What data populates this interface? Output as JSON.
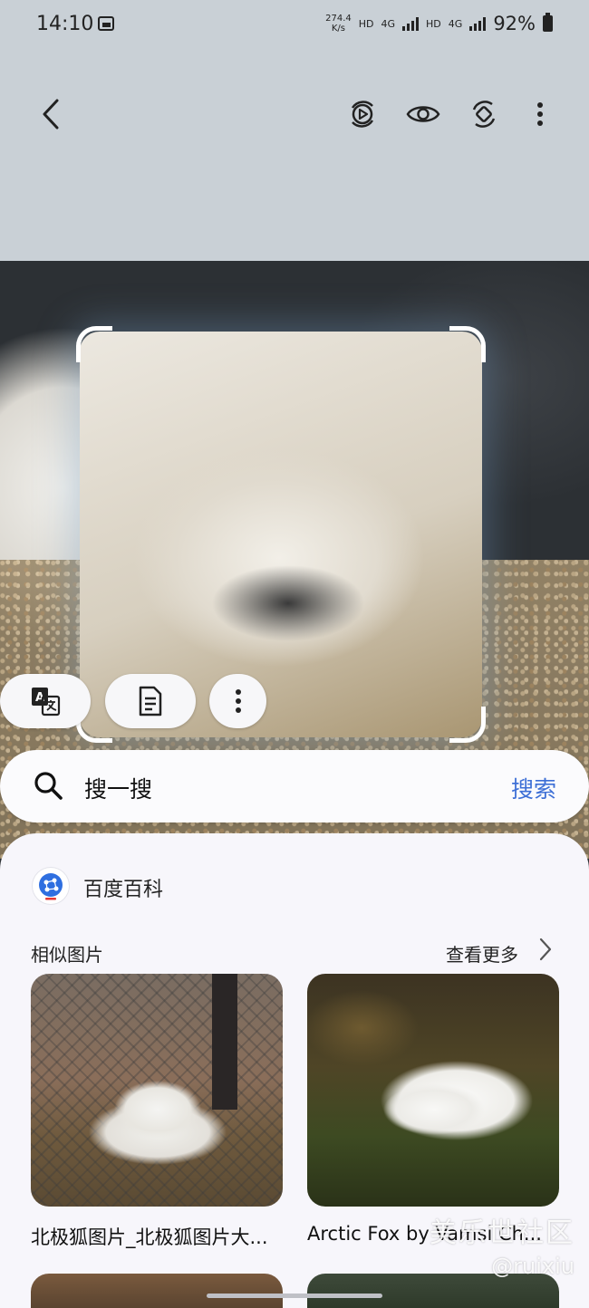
{
  "status_bar": {
    "time": "14:10",
    "speed_value": "274.4",
    "speed_unit": "K/s",
    "hd1": "HD",
    "net1": "4G",
    "hd2": "HD",
    "net2": "4G",
    "battery": "92%"
  },
  "toolbar": {
    "icons": [
      "back-icon",
      "live-photo-icon",
      "eye-icon",
      "rotate-icon",
      "more-vert-icon"
    ]
  },
  "actions": {
    "icons": [
      "translate-icon",
      "document-icon",
      "more-vert-icon"
    ]
  },
  "search": {
    "query": "搜一搜",
    "button": "搜索"
  },
  "results": {
    "source_name": "百度百科",
    "section_title": "相似图片",
    "more_label": "查看更多",
    "items": [
      {
        "caption": "北极狐图片_北极狐图片大..."
      },
      {
        "caption": "Arctic Fox by Vamsi Ch..."
      }
    ]
  },
  "watermark": {
    "line1": "美乐世社区",
    "line2": "@ruixiu"
  },
  "colors": {
    "accent": "#3d6fd6",
    "panel_bg": "#f7f6fb",
    "top_bg": "#c9d0d6"
  }
}
